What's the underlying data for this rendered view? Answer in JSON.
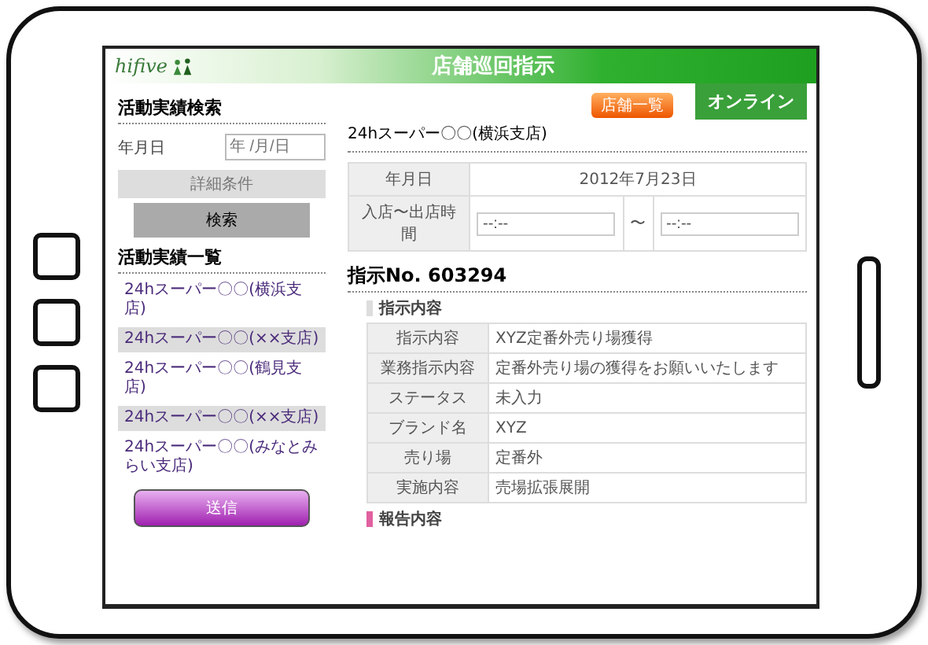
{
  "header": {
    "logo": "hifive",
    "title": "店舗巡回指示"
  },
  "toolbar": {
    "list_button": "店舗一覧",
    "status_tab": "オンライン"
  },
  "search": {
    "heading": "活動実績検索",
    "date_label": "年月日",
    "date_placeholder": "年 /月/日",
    "detail_button": "詳細条件",
    "search_button": "検索"
  },
  "results": {
    "heading": "活動実績一覧",
    "items": [
      {
        "label": "24hスーパー〇〇(横浜支店)",
        "shaded": false
      },
      {
        "label": "24hスーパー〇〇(××支店)",
        "shaded": true
      },
      {
        "label": "24hスーパー〇〇(鶴見支店)",
        "shaded": false
      },
      {
        "label": "24hスーパー〇〇(××支店)",
        "shaded": true
      },
      {
        "label": "24hスーパー〇〇(みなとみらい支店)",
        "shaded": false
      }
    ],
    "send_button": "送信"
  },
  "store": {
    "name": "24hスーパー〇〇(横浜支店)",
    "date_label": "年月日",
    "date_value": "2012年7月23日",
    "time_label": "入店〜出店時間",
    "time_from": "--:--",
    "time_sep": "〜",
    "time_to": "--:--"
  },
  "instruction": {
    "heading": "指示No. 603294",
    "section": "指示内容",
    "rows": [
      {
        "label": "指示内容",
        "value": "XYZ定番外売り場獲得"
      },
      {
        "label": "業務指示内容",
        "value": "定番外売り場の獲得をお願いいたします"
      },
      {
        "label": "ステータス",
        "value": "未入力"
      },
      {
        "label": "ブランド名",
        "value": "XYZ"
      },
      {
        "label": "売り場",
        "value": "定番外"
      },
      {
        "label": "実施内容",
        "value": "売場拡張展開"
      }
    ],
    "report_section": "報告内容"
  }
}
